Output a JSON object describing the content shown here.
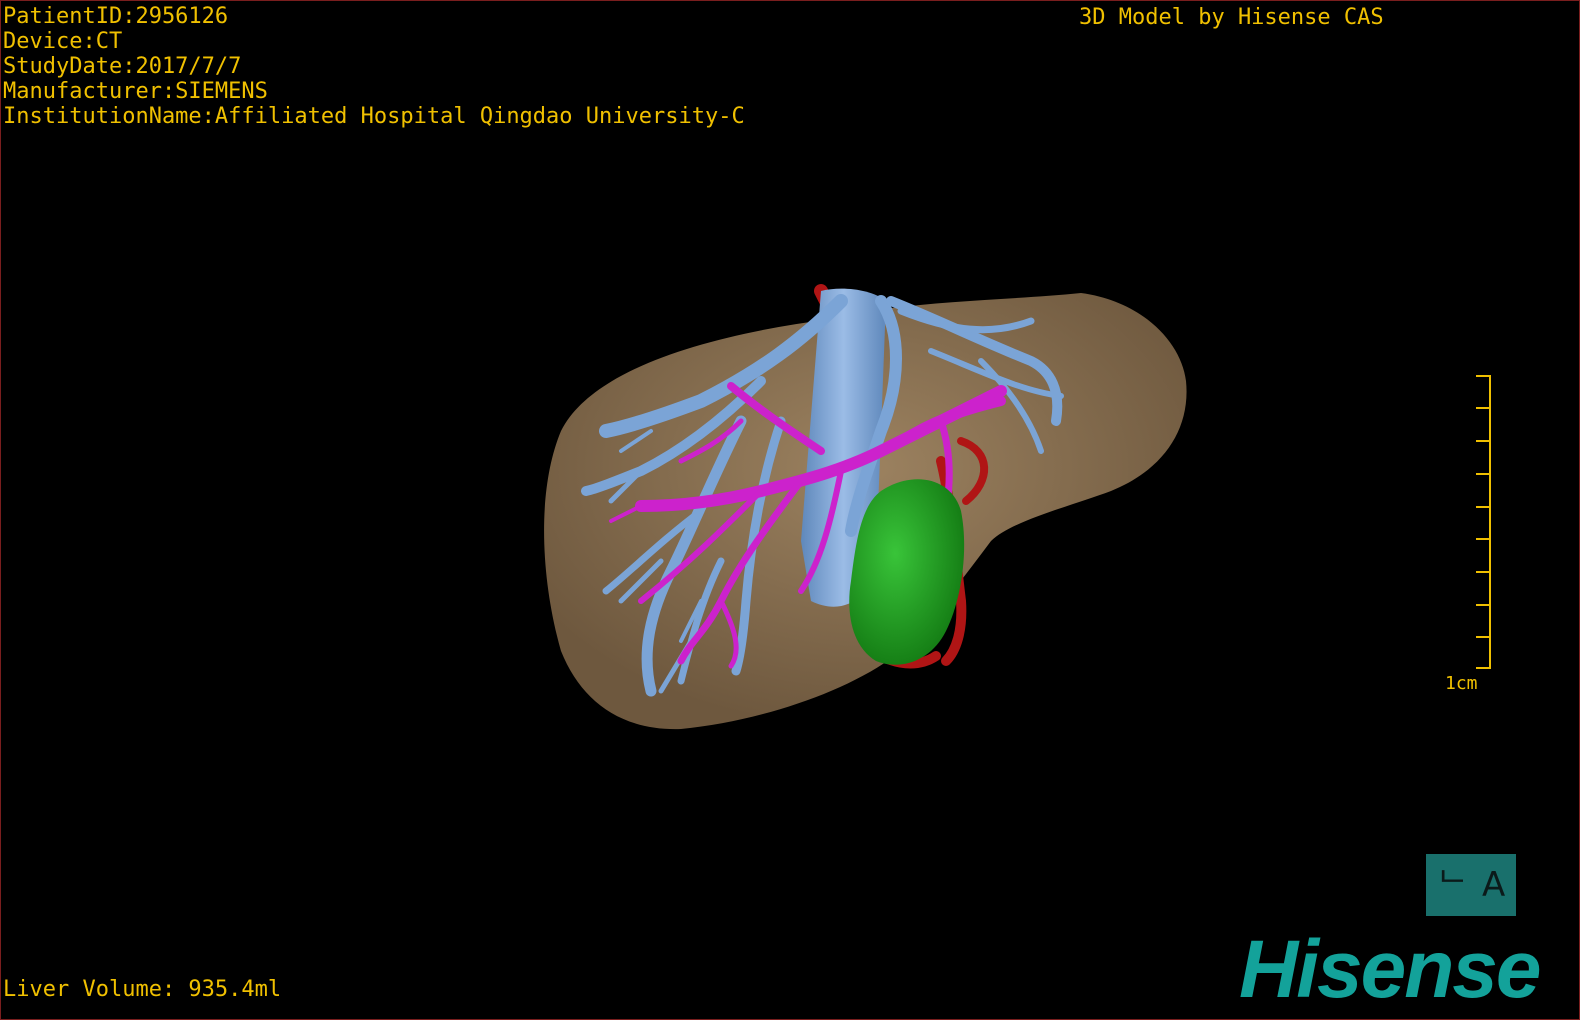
{
  "overlay": {
    "patient_id": "PatientID:2956126",
    "device": "Device:CT",
    "study_date": "StudyDate:2017/7/7",
    "manufacturer": "Manufacturer:SIEMENS",
    "institution": "InstitutionName:Affiliated Hospital Qingdao University-C",
    "credit": "3D Model by Hisense CAS",
    "liver_volume": "Liver Volume: 935.4ml"
  },
  "scale_bar": {
    "label": "1cm"
  },
  "orientation_cube": {
    "left_glyph": "ᄂ",
    "right_glyph": "A"
  },
  "logo": {
    "text": "Hisense"
  },
  "colors": {
    "overlay_text": "#f0c000",
    "liver": "#8b7355",
    "hepatic_vein": "#7ba4d6",
    "portal_vein": "#cc22cc",
    "artery": "#b01515",
    "tumor": "#22aa22",
    "brand": "#13a29a"
  }
}
